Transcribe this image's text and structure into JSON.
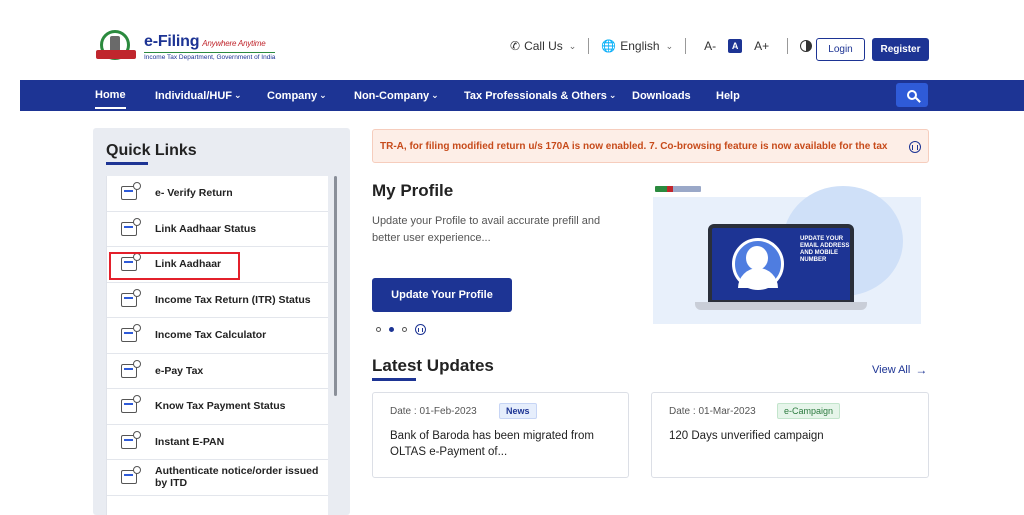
{
  "header": {
    "logo_title": "e-Filing",
    "logo_tagline": "Anywhere Anytime",
    "logo_subtitle": "Income Tax Department, Government of India",
    "call_us": "Call Us",
    "language": "English",
    "font_decrease": "A-",
    "font_normal": "A",
    "font_increase": "A+",
    "login": "Login",
    "register": "Register"
  },
  "nav": {
    "items": [
      {
        "label": "Home"
      },
      {
        "label": "Individual/HUF"
      },
      {
        "label": "Company"
      },
      {
        "label": "Non-Company"
      },
      {
        "label": "Tax Professionals & Others"
      },
      {
        "label": "Downloads"
      },
      {
        "label": "Help"
      }
    ]
  },
  "quick_links": {
    "title": "Quick Links",
    "items": [
      {
        "label": "e- Verify Return",
        "icon": "verify-return-icon"
      },
      {
        "label": "Link Aadhaar Status",
        "icon": "aadhaar-card-icon"
      },
      {
        "label": "Link Aadhaar",
        "icon": "aadhaar-card-icon"
      },
      {
        "label": "Income Tax Return (ITR) Status",
        "icon": "itr-status-icon"
      },
      {
        "label": "Income Tax Calculator",
        "icon": "calculator-icon"
      },
      {
        "label": "e-Pay Tax",
        "icon": "e-pay-icon"
      },
      {
        "label": "Know Tax Payment Status",
        "icon": "payment-status-icon"
      },
      {
        "label": "Instant E-PAN",
        "icon": "pan-card-icon"
      },
      {
        "label": "Authenticate notice/order issued by ITD",
        "icon": "authenticate-icon"
      }
    ]
  },
  "ticker": {
    "text": "TR-A, for filing modified return u/s 170A is now enabled. 7. Co-browsing feature is now available for the tax"
  },
  "profile": {
    "title": "My Profile",
    "description": "Update your Profile to avail accurate prefill and better user experience...",
    "button": "Update Your Profile",
    "banner_text": "UPDATE YOUR EMAIL ADDRESS AND MOBILE NUMBER"
  },
  "updates": {
    "title": "Latest Updates",
    "view_all": "View All",
    "cards": [
      {
        "date": "Date : 01-Feb-2023",
        "badge": "News",
        "text": "Bank of Baroda has been migrated from OLTAS e-Payment of..."
      },
      {
        "date": "Date : 01-Mar-2023",
        "badge": "e-Campaign",
        "text": "120 Days unverified campaign"
      }
    ]
  },
  "colors": {
    "brand": "#1d3494",
    "alert_text": "#c74b1b",
    "highlight": "#e3202b"
  }
}
